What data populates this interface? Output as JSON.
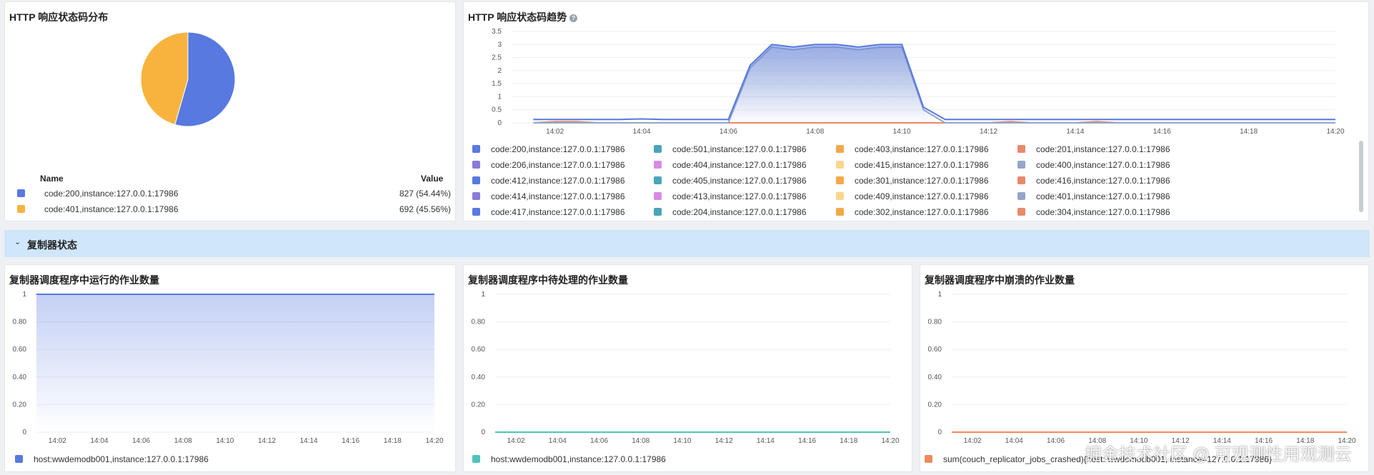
{
  "panels": {
    "pie": {
      "title": "HTTP 响应状态码分布",
      "legend_name_header": "Name",
      "legend_value_header": "Value",
      "rows": [
        {
          "name": "code:200,instance:127.0.0.1:17986",
          "value": "827 (54.44%)",
          "color": "#5779e0"
        },
        {
          "name": "code:401,instance:127.0.0.1:17986",
          "value": "692 (45.56%)",
          "color": "#f8b33e"
        }
      ]
    },
    "trend": {
      "title": "HTTP 响应状态码趋势",
      "help_icon": "question-circle-icon",
      "legend": [
        {
          "name": "code:200,instance:127.0.0.1:17986",
          "color": "#5779e0"
        },
        {
          "name": "code:501,instance:127.0.0.1:17986",
          "color": "#4aa5b8"
        },
        {
          "name": "code:403,instance:127.0.0.1:17986",
          "color": "#f2a94a"
        },
        {
          "name": "code:201,instance:127.0.0.1:17986",
          "color": "#e88a6a"
        },
        {
          "name": "code:206,instance:127.0.0.1:17986",
          "color": "#8c7ad9"
        },
        {
          "name": "code:404,instance:127.0.0.1:17986",
          "color": "#d78be3"
        },
        {
          "name": "code:415,instance:127.0.0.1:17986",
          "color": "#f9d690"
        },
        {
          "name": "code:400,instance:127.0.0.1:17986",
          "color": "#94a6c7"
        },
        {
          "name": "code:412,instance:127.0.0.1:17986",
          "color": "#5779e0"
        },
        {
          "name": "code:405,instance:127.0.0.1:17986",
          "color": "#4aa5b8"
        },
        {
          "name": "code:301,instance:127.0.0.1:17986",
          "color": "#f2a94a"
        },
        {
          "name": "code:416,instance:127.0.0.1:17986",
          "color": "#e88a6a"
        },
        {
          "name": "code:414,instance:127.0.0.1:17986",
          "color": "#8c7ad9"
        },
        {
          "name": "code:413,instance:127.0.0.1:17986",
          "color": "#d78be3"
        },
        {
          "name": "code:409,instance:127.0.0.1:17986",
          "color": "#f9d690"
        },
        {
          "name": "code:401,instance:127.0.0.1:17986",
          "color": "#94a6c7"
        },
        {
          "name": "code:417,instance:127.0.0.1:17986",
          "color": "#5779e0"
        },
        {
          "name": "code:204,instance:127.0.0.1:17986",
          "color": "#4aa5b8"
        },
        {
          "name": "code:302,instance:127.0.0.1:17986",
          "color": "#f2a94a"
        },
        {
          "name": "code:304,instance:127.0.0.1:17986",
          "color": "#e88a6a"
        }
      ]
    },
    "running": {
      "title": "复制器调度程序中运行的作业数量",
      "legend": [
        {
          "name": "host:wwdemodb001,instance:127.0.0.1:17986",
          "color": "#5779e0"
        }
      ]
    },
    "pending": {
      "title": "复制器调度程序中待处理的作业数量",
      "legend": [
        {
          "name": "host:wwdemodb001,instance:127.0.0.1:17986",
          "color": "#4fc4bd"
        }
      ]
    },
    "crashed": {
      "title": "复制器调度程序中崩溃的作业数量",
      "legend": [
        {
          "name": "sum(couch_replicator_jobs_crashed){host: wwdemodb001, instance=127.0.0.1:17986}",
          "color": "#f08a5d"
        }
      ]
    }
  },
  "section": {
    "title": "复制器状态",
    "toggle_icon": "chevron-down-icon"
  },
  "watermark": "掘金技术社区 @ 可观测性用观测云",
  "chart_data": [
    {
      "type": "pie",
      "title": "HTTP 响应状态码分布",
      "categories": [
        "code:200,instance:127.0.0.1:17986",
        "code:401,instance:127.0.0.1:17986"
      ],
      "values": [
        827,
        692
      ],
      "colors": [
        "#5779e0",
        "#f8b33e"
      ],
      "legend": "bottom"
    },
    {
      "type": "area",
      "title": "HTTP 响应状态码趋势",
      "x": [
        "14:01:30",
        "14:02",
        "14:02:30",
        "14:03",
        "14:03:30",
        "14:04",
        "14:04:30",
        "14:05",
        "14:05:30",
        "14:06",
        "14:06:30",
        "14:07",
        "14:07:30",
        "14:08",
        "14:08:30",
        "14:09",
        "14:09:30",
        "14:10",
        "14:10:30",
        "14:11",
        "14:11:30",
        "14:12",
        "14:12:30",
        "14:13",
        "14:13:30",
        "14:14",
        "14:14:30",
        "14:15",
        "14:15:30",
        "14:16",
        "14:16:30",
        "14:17",
        "14:17:30",
        "14:18",
        "14:18:30",
        "14:19",
        "14:19:30",
        "14:20"
      ],
      "xticks": [
        "14:02",
        "14:04",
        "14:06",
        "14:08",
        "14:10",
        "14:12",
        "14:14",
        "14:16",
        "14:18",
        "14:20"
      ],
      "yticks": [
        "0",
        "0.5",
        "1",
        "1.5",
        "2",
        "2.5",
        "3",
        "3.5"
      ],
      "ylim": [
        0,
        3.5
      ],
      "grid": true,
      "legend": "bottom",
      "series": [
        {
          "name": "code:200,instance:127.0.0.1:17986",
          "color": "#5779e0",
          "values": [
            0.13,
            0.13,
            0.13,
            0.13,
            0.13,
            0.15,
            0.13,
            0.13,
            0.13,
            0.13,
            2.2,
            3.0,
            2.9,
            3.0,
            3.0,
            2.9,
            3.0,
            3.0,
            0.6,
            0.13,
            0.13,
            0.13,
            0.13,
            0.13,
            0.13,
            0.13,
            0.13,
            0.13,
            0.13,
            0.13,
            0.13,
            0.13,
            0.13,
            0.13,
            0.13,
            0.13,
            0.13,
            0.13
          ]
        },
        {
          "name": "code:401,instance:127.0.0.1:17986",
          "color": "#94a6c7",
          "values": [
            0.0,
            0.0,
            0.0,
            0.0,
            0.0,
            0.0,
            0.0,
            0.0,
            0.0,
            0.0,
            2.1,
            2.9,
            2.8,
            2.9,
            2.9,
            2.8,
            2.9,
            2.9,
            0.5,
            0.0,
            0.0,
            0.0,
            0.0,
            0.0,
            0.0,
            0.0,
            0.0,
            0.0,
            0.0,
            0.0,
            0.0,
            0.0,
            0.0,
            0.0,
            0.0,
            0.0,
            0.0,
            0.0
          ]
        },
        {
          "name": "code:201,instance:127.0.0.1:17986",
          "color": "#e88a6a",
          "values": [
            0,
            0.05,
            0.05,
            0,
            0,
            0,
            0,
            0,
            0,
            0,
            0,
            0,
            0,
            0,
            0,
            0,
            0,
            0,
            0,
            0,
            0,
            0,
            0.05,
            0,
            0,
            0,
            0.05,
            0,
            0,
            0,
            0,
            0,
            0,
            0,
            0,
            0,
            0,
            0
          ]
        }
      ]
    },
    {
      "type": "area",
      "title": "复制器调度程序中运行的作业数量",
      "x": [
        "14:01",
        "14:20"
      ],
      "xticks": [
        "14:02",
        "14:04",
        "14:06",
        "14:08",
        "14:10",
        "14:12",
        "14:14",
        "14:16",
        "14:18",
        "14:20"
      ],
      "yticks": [
        "0",
        "0.20",
        "0.40",
        "0.60",
        "0.80",
        "1"
      ],
      "ylim": [
        0,
        1
      ],
      "grid": true,
      "legend": "bottom",
      "series": [
        {
          "name": "host:wwdemodb001,instance:127.0.0.1:17986",
          "color": "#5779e0",
          "values": [
            1,
            1
          ]
        }
      ]
    },
    {
      "type": "area",
      "title": "复制器调度程序中待处理的作业数量",
      "x": [
        "14:01",
        "14:20"
      ],
      "xticks": [
        "14:02",
        "14:04",
        "14:06",
        "14:08",
        "14:10",
        "14:12",
        "14:14",
        "14:16",
        "14:18",
        "14:20"
      ],
      "yticks": [
        "0",
        "0.20",
        "0.40",
        "0.60",
        "0.80",
        "1"
      ],
      "ylim": [
        0,
        1
      ],
      "grid": true,
      "legend": "bottom",
      "series": [
        {
          "name": "host:wwdemodb001,instance:127.0.0.1:17986",
          "color": "#4fc4bd",
          "values": [
            0,
            0
          ]
        }
      ]
    },
    {
      "type": "area",
      "title": "复制器调度程序中崩溃的作业数量",
      "x": [
        "14:01",
        "14:20"
      ],
      "xticks": [
        "14:02",
        "14:04",
        "14:06",
        "14:08",
        "14:10",
        "14:12",
        "14:14",
        "14:16",
        "14:18",
        "14:20"
      ],
      "yticks": [
        "0",
        "0.20",
        "0.40",
        "0.60",
        "0.80",
        "1"
      ],
      "ylim": [
        0,
        1
      ],
      "grid": true,
      "legend": "bottom",
      "series": [
        {
          "name": "sum(couch_replicator_jobs_crashed){host: wwdemodb001, instance=127.0.0.1:17986}",
          "color": "#f08a5d",
          "values": [
            0,
            0
          ]
        }
      ]
    }
  ]
}
